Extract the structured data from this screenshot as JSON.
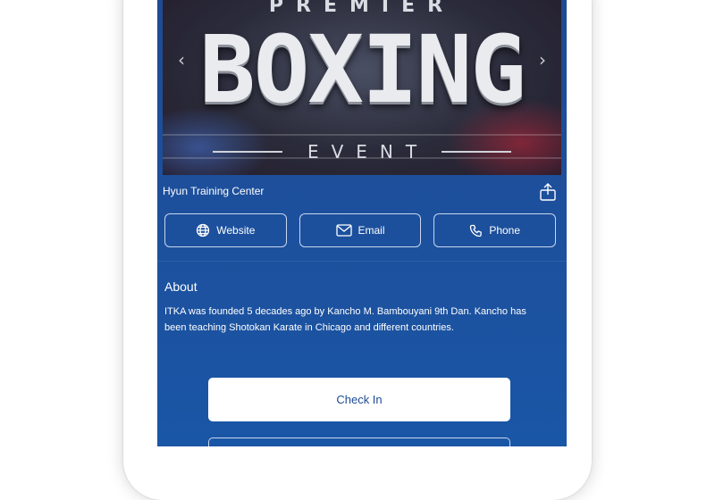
{
  "banner": {
    "premier": "PREMIER",
    "title": "BOXING",
    "event": "EVENT",
    "prev_icon": "chevron-left-icon",
    "next_icon": "chevron-right-icon"
  },
  "venue": {
    "name": "Hyun Training Center",
    "share_icon": "share-icon"
  },
  "actions": [
    {
      "label": "Website",
      "icon": "globe-icon"
    },
    {
      "label": "Email",
      "icon": "mail-icon"
    },
    {
      "label": "Phone",
      "icon": "phone-icon"
    }
  ],
  "about": {
    "heading": "About",
    "text": "ITKA was founded 5 decades ago by Kancho M. Bambouyani 9th Dan. Kancho has been teaching Shotokan Karate in Chicago and different countries."
  },
  "checkin": {
    "label": "Check In"
  },
  "colors": {
    "screen_bg": "#1e4b93",
    "button_text": "#1d4b94"
  }
}
